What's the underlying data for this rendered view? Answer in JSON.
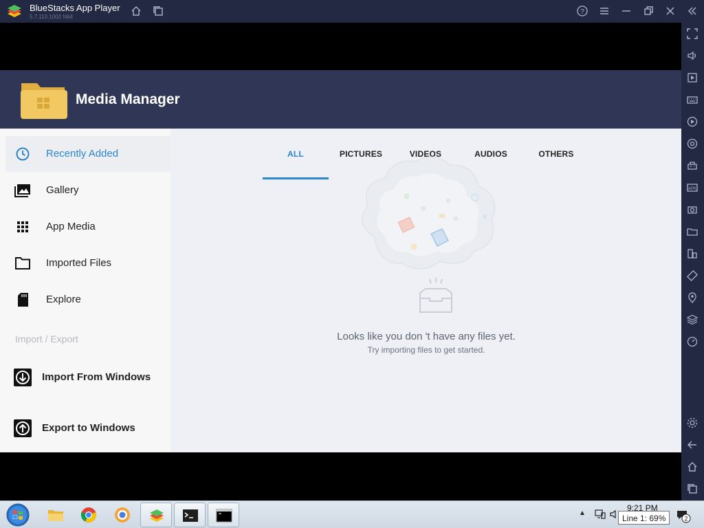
{
  "window": {
    "title": "BlueStacks App Player",
    "version": "5.7.110.1002  N64"
  },
  "app": {
    "title": "Media Manager",
    "nav": {
      "items": [
        {
          "label": "Recently Added"
        },
        {
          "label": "Gallery"
        },
        {
          "label": "App Media"
        },
        {
          "label": "Imported Files"
        },
        {
          "label": "Explore"
        }
      ],
      "section_label": "Import / Export",
      "import_label": "Import From Windows",
      "export_label": "Export to Windows"
    },
    "tabs": [
      {
        "label": "ALL"
      },
      {
        "label": "PICTURES"
      },
      {
        "label": "VIDEOS"
      },
      {
        "label": "AUDIOS"
      },
      {
        "label": "OTHERS"
      }
    ],
    "empty_state": {
      "title": "Looks like you don 't have any files yet.",
      "subtitle": "Try importing files to get started."
    }
  },
  "taskbar": {
    "clock": "9:21 PM",
    "tooltip": "Line 1: 69%",
    "notification_count": "2"
  },
  "colors": {
    "accent": "#2d86c9",
    "titlebar": "#232943",
    "header": "#2f3656",
    "folder": "#f2c862"
  }
}
